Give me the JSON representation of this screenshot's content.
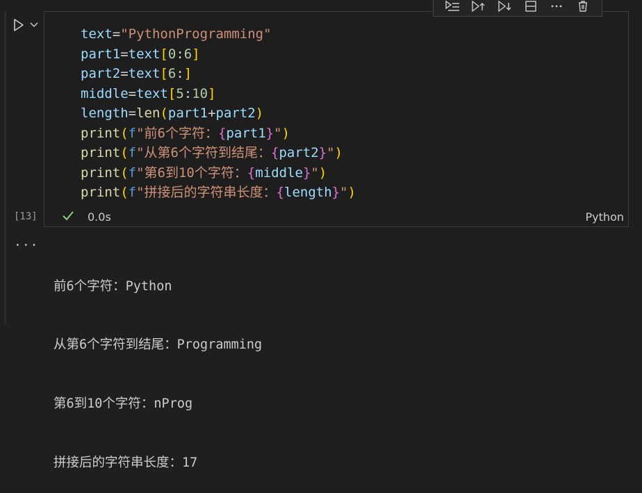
{
  "cell": {
    "execution_count": "[13]",
    "status": {
      "duration": "0.0s",
      "language": "Python"
    },
    "code_lines": [
      [
        {
          "t": "text",
          "c": "var"
        },
        {
          "t": "=",
          "c": "op"
        },
        {
          "t": "\"PythonProgramming\"",
          "c": "str"
        }
      ],
      [
        {
          "t": "part1",
          "c": "var"
        },
        {
          "t": "=",
          "c": "op"
        },
        {
          "t": "text",
          "c": "var"
        },
        {
          "t": "[",
          "c": "b1"
        },
        {
          "t": "0",
          "c": "num"
        },
        {
          "t": ":",
          "c": "op"
        },
        {
          "t": "6",
          "c": "num"
        },
        {
          "t": "]",
          "c": "b1"
        }
      ],
      [
        {
          "t": "part2",
          "c": "var"
        },
        {
          "t": "=",
          "c": "op"
        },
        {
          "t": "text",
          "c": "var"
        },
        {
          "t": "[",
          "c": "b1"
        },
        {
          "t": "6",
          "c": "num"
        },
        {
          "t": ":",
          "c": "op"
        },
        {
          "t": "]",
          "c": "b1"
        }
      ],
      [
        {
          "t": "middle",
          "c": "var"
        },
        {
          "t": "=",
          "c": "op"
        },
        {
          "t": "text",
          "c": "var"
        },
        {
          "t": "[",
          "c": "b1"
        },
        {
          "t": "5",
          "c": "num"
        },
        {
          "t": ":",
          "c": "op"
        },
        {
          "t": "10",
          "c": "num"
        },
        {
          "t": "]",
          "c": "b1"
        }
      ],
      [
        {
          "t": "length",
          "c": "var"
        },
        {
          "t": "=",
          "c": "op"
        },
        {
          "t": "len",
          "c": "fn"
        },
        {
          "t": "(",
          "c": "b1"
        },
        {
          "t": "part1",
          "c": "var"
        },
        {
          "t": "+",
          "c": "op"
        },
        {
          "t": "part2",
          "c": "var"
        },
        {
          "t": ")",
          "c": "b1"
        }
      ],
      [
        {
          "t": "print",
          "c": "fn"
        },
        {
          "t": "(",
          "c": "b1"
        },
        {
          "t": "f",
          "c": "kw"
        },
        {
          "t": "\"前6个字符：",
          "c": "str"
        },
        {
          "t": "{",
          "c": "b2"
        },
        {
          "t": "part1",
          "c": "var"
        },
        {
          "t": "}",
          "c": "b2"
        },
        {
          "t": "\"",
          "c": "str"
        },
        {
          "t": ")",
          "c": "b1"
        }
      ],
      [
        {
          "t": "print",
          "c": "fn"
        },
        {
          "t": "(",
          "c": "b1"
        },
        {
          "t": "f",
          "c": "kw"
        },
        {
          "t": "\"从第6个字符到结尾：",
          "c": "str"
        },
        {
          "t": "{",
          "c": "b2"
        },
        {
          "t": "part2",
          "c": "var"
        },
        {
          "t": "}",
          "c": "b2"
        },
        {
          "t": "\"",
          "c": "str"
        },
        {
          "t": ")",
          "c": "b1"
        }
      ],
      [
        {
          "t": "print",
          "c": "fn"
        },
        {
          "t": "(",
          "c": "b1"
        },
        {
          "t": "f",
          "c": "kw"
        },
        {
          "t": "\"第6到10个字符：",
          "c": "str"
        },
        {
          "t": "{",
          "c": "b2"
        },
        {
          "t": "middle",
          "c": "var"
        },
        {
          "t": "}",
          "c": "b2"
        },
        {
          "t": "\"",
          "c": "str"
        },
        {
          "t": ")",
          "c": "b1"
        }
      ],
      [
        {
          "t": "print",
          "c": "fn"
        },
        {
          "t": "(",
          "c": "b1"
        },
        {
          "t": "f",
          "c": "kw"
        },
        {
          "t": "\"拼接后的字符串长度：",
          "c": "str"
        },
        {
          "t": "{",
          "c": "b2"
        },
        {
          "t": "length",
          "c": "var"
        },
        {
          "t": "}",
          "c": "b2"
        },
        {
          "t": "\"",
          "c": "str"
        },
        {
          "t": ")",
          "c": "b1"
        }
      ]
    ]
  },
  "toolbar": {
    "icons": [
      "run-by-line-icon",
      "run-above-icon",
      "run-below-icon",
      "split-cell-icon",
      "more-actions-icon",
      "delete-cell-icon"
    ]
  },
  "output": {
    "more_label": "···",
    "lines": [
      "前6个字符：Python",
      "从第6个字符到结尾：Programming",
      "第6到10个字符：nProg",
      "拼接后的字符串长度：17"
    ]
  },
  "colors": {
    "background": "#1f1f1f",
    "string": "#ce9178",
    "variable": "#9cdcfe",
    "function": "#dcdcaa",
    "success": "#89d185"
  }
}
